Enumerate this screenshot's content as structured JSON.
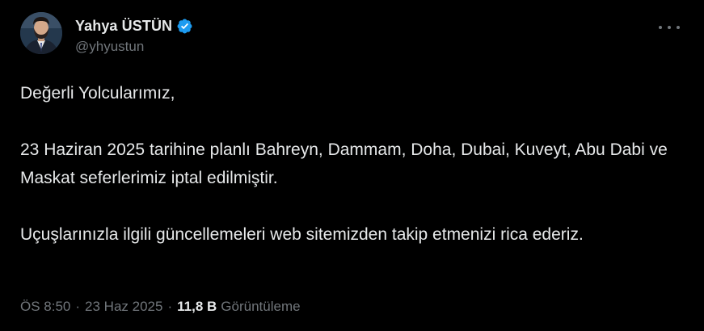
{
  "author": {
    "display_name": "Yahya ÜSTÜN",
    "handle": "@yhyustun",
    "verified": true
  },
  "tweet": {
    "paragraphs": [
      "Değerli Yolcularımız,",
      "23 Haziran 2025 tarihine planlı Bahreyn, Dammam, Doha, Dubai, Kuveyt, Abu Dabi ve Maskat seferlerimiz iptal edilmiştir.",
      "Uçuşlarınızla ilgili güncellemeleri web sitemizden takip etmenizi rica ederiz."
    ]
  },
  "meta": {
    "time": "ÖS 8:50",
    "separator": "·",
    "date": "23 Haz 2025",
    "views_count": "11,8 B",
    "views_label": "Görüntüleme"
  },
  "colors": {
    "background": "#000000",
    "text": "#e7e9ea",
    "secondary": "#71767b",
    "verified": "#1d9bf0"
  },
  "icons": {
    "verified": "verified-badge-icon",
    "more": "more-horizontal-icon"
  }
}
